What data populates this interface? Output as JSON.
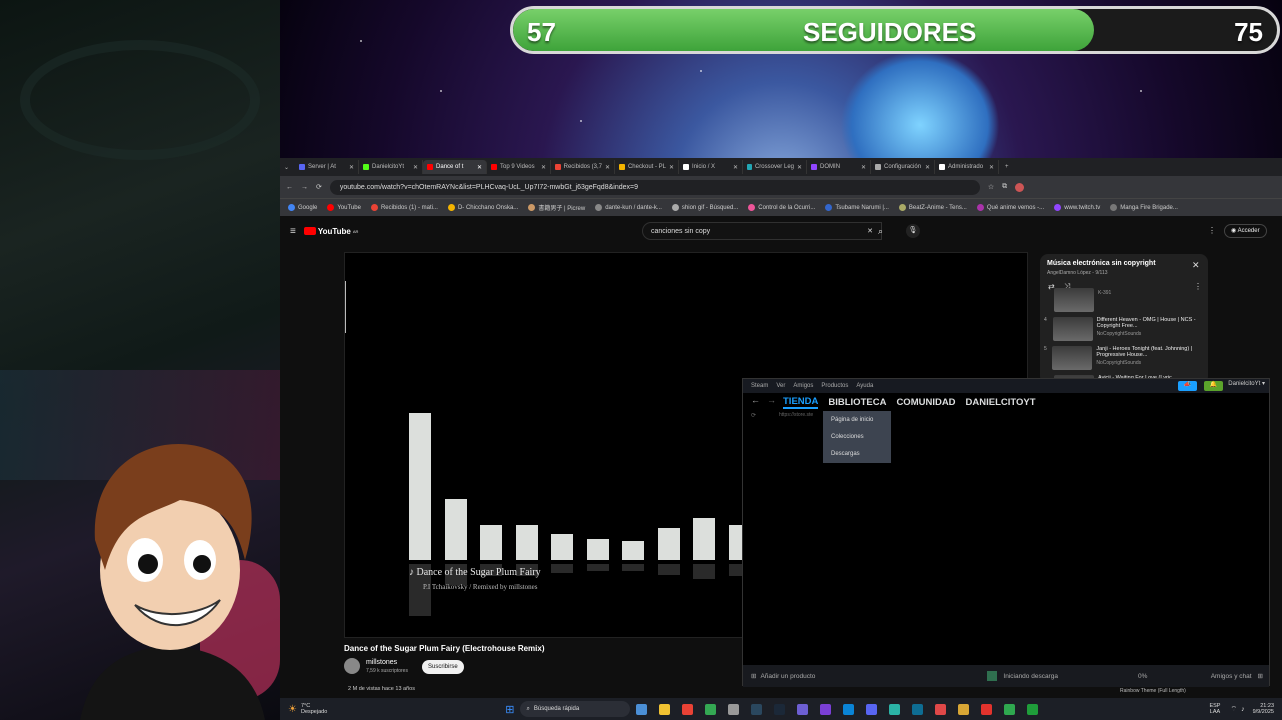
{
  "followers": {
    "current": "57",
    "label": "SEGUIDORES",
    "goal": "75",
    "progress_fraction": 0.76,
    "colors": {
      "fill": "#4caf42",
      "track": "#1b1b1b",
      "border": "#d8d8d8"
    }
  },
  "browser": {
    "tabs": [
      {
        "label": "Server | At",
        "icon": "discord-icon",
        "color": "#5865f2"
      },
      {
        "label": "DanielcitoYt",
        "icon": "kick-icon",
        "color": "#53fc18"
      },
      {
        "label": "Dance of t",
        "icon": "youtube-icon",
        "color": "#ff0000",
        "active": true
      },
      {
        "label": "Top 9 Videos",
        "icon": "youtube-icon",
        "color": "#ff0000"
      },
      {
        "label": "Recibidos (3,7",
        "icon": "gmail-icon",
        "color": "#ea4335"
      },
      {
        "label": "Checkout - PL",
        "icon": "checkout-icon",
        "color": "#f4b400"
      },
      {
        "label": "Inicio / X",
        "icon": "x-icon",
        "color": "#ffffff"
      },
      {
        "label": "Crossover Leg",
        "icon": "page-icon",
        "color": "#22a6b3"
      },
      {
        "label": "DOMIN",
        "icon": "twitch-icon",
        "color": "#9146ff"
      },
      {
        "label": "Configuración",
        "icon": "gear-icon",
        "color": "#aaaaaa"
      },
      {
        "label": "Administrado",
        "icon": "page-icon",
        "color": "#ffffff"
      }
    ],
    "url": "youtube.com/watch?v=chOtemRAYNc&list=PLHCvaq-UcL_Up7I72-mwbGt_j63geFqd8&index=9",
    "bookmarks": [
      "Google",
      "YouTube",
      "Recibidos (1) - mati...",
      "D- Chicchano Onska...",
      "書籍男子 | Picrew",
      "dante-kun / dante-k...",
      "shion gif - Búsqued...",
      "Control de la Ocurri...",
      "Tsubame Narumi |...",
      "BeatZ-Anime - Tens...",
      "Qué anime vemos -...",
      "www.twitch.tv",
      "Manga Fire Brigade..."
    ]
  },
  "youtube": {
    "logo": "YouTube",
    "logo_sup": "AR",
    "search_value": "canciones sin copy",
    "signin": "Acceder",
    "video_song": "Dance of the Sugar Plum Fairy",
    "video_credit": "P.I Tchaikovsky / Remixed by millstones",
    "title": "Dance of the Sugar Plum Fairy (Electrohouse Remix)",
    "channel": "millstones",
    "subscribers": "7,59 k suscriptores",
    "subscribe": "Suscribirse",
    "meta": "2 M de vistas  hace 13 años"
  },
  "playlist": {
    "title": "Música electrónica sin copyright",
    "owner": "AngelDamno López - 9/113",
    "items": [
      {
        "num": "",
        "title": "",
        "channel": "K-391"
      },
      {
        "num": "4",
        "title": "Different Heaven - OMG | House | NCS - Copyright Free...",
        "channel": "NoCopyrightSounds"
      },
      {
        "num": "5",
        "title": "Janji - Heroes Tonight (feat. Johnning) | Progressive House...",
        "channel": "NoCopyrightSounds"
      },
      {
        "num": "",
        "title": "Avicii - Waiting For Love (Lyric",
        "channel": ""
      }
    ]
  },
  "steam": {
    "menu": [
      "Steam",
      "Ver",
      "Amigos",
      "Productos",
      "Ayuda"
    ],
    "nav": [
      "TIENDA",
      "BIBLIOTECA",
      "COMUNIDAD",
      "DANIELCITOYT"
    ],
    "user": "DanielcitoYt",
    "url_hint": "https://store.ste",
    "dropdown": [
      "Página de inicio",
      "Colecciones",
      "Descargas"
    ],
    "footer_add": "Añadir un producto",
    "footer_download": "Iniciando descarga",
    "footer_pct": "0%",
    "footer_friends": "Amigos y chat"
  },
  "taskbar": {
    "weather_temp": "7°C",
    "weather_desc": "Despejado",
    "search": "Búsqueda rápida",
    "lang": "ESP",
    "lang2": "LAA",
    "time": "21:23",
    "date": "9/9/2025"
  },
  "bars": [
    0.92,
    0.38,
    0.22,
    0.22,
    0.16,
    0.13,
    0.12,
    0.2,
    0.26,
    0.22
  ],
  "background_bottom_item": "Rainbow Theme (Full Length)"
}
